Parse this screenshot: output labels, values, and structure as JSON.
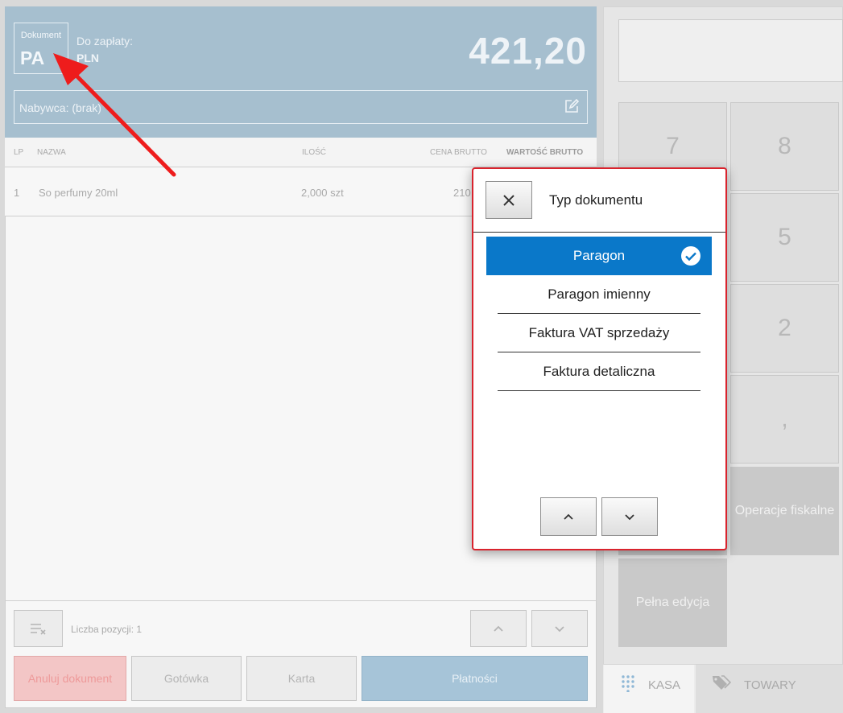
{
  "header": {
    "document_label": "Dokument",
    "document_code": "PA",
    "pay_label": "Do zapłaty:",
    "currency": "PLN",
    "amount": "421,20",
    "buyer": "Nabywca: (brak)"
  },
  "table": {
    "columns": [
      "LP",
      "NAZWA",
      "ILOŚĆ",
      "CENA BRUTTO",
      "WARTOŚĆ BRUTTO"
    ],
    "rows": [
      {
        "lp": "1",
        "name": "So perfumy 20ml",
        "qty": "2,000 szt",
        "price": "210"
      }
    ]
  },
  "footer": {
    "count_label": "Liczba pozycji: 1",
    "cancel_label": "Anuluj dokument",
    "cash_label": "Gotówka",
    "card_label": "Karta",
    "payments_label": "Płatności"
  },
  "keypad": {
    "keys": [
      "7",
      "8",
      "5",
      "2",
      ","
    ],
    "fiscal_label": "Operacje fiskalne",
    "full_edit_label": "Pełna edycja"
  },
  "tabs": {
    "kasa": "KASA",
    "towary": "TOWARY"
  },
  "modal": {
    "title": "Typ dokumentu",
    "options": [
      {
        "label": "Paragon",
        "selected": true
      },
      {
        "label": "Paragon imienny",
        "selected": false
      },
      {
        "label": "Faktura VAT sprzedaży",
        "selected": false
      },
      {
        "label": "Faktura detaliczna",
        "selected": false
      }
    ]
  },
  "colors": {
    "header_bg": "#a6bfcf",
    "selected_option": "#0a78c9",
    "modal_border": "#d9232d",
    "cancel_button": "#f3c6c6",
    "payments_button": "#a6c4d8",
    "annotation_arrow": "#ee1c1c"
  },
  "icons": {
    "edit": "edit-icon",
    "close": "close-icon",
    "check": "check-circle-icon",
    "up": "chevron-up-icon",
    "down": "chevron-down-icon",
    "clear": "clear-list-icon",
    "keypad": "keypad-icon",
    "tag": "tag-icon"
  }
}
